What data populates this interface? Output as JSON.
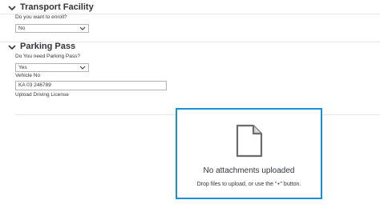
{
  "transport": {
    "title": "Transport Facility",
    "enroll_label": "Do you want to enroll?",
    "enroll_value": "No"
  },
  "parking": {
    "title": "Parking Pass",
    "need_label": "Do You need Parking Pass?",
    "need_value": "Yes",
    "vehicle_label": "Vehicle No",
    "vehicle_value": "KA 03 246789",
    "license_label": "Upload Driving License"
  },
  "upload": {
    "title": "No attachments uploaded",
    "hint": "Drop files to upload, or use the \"+\" button.",
    "accent": "#1592d3"
  }
}
